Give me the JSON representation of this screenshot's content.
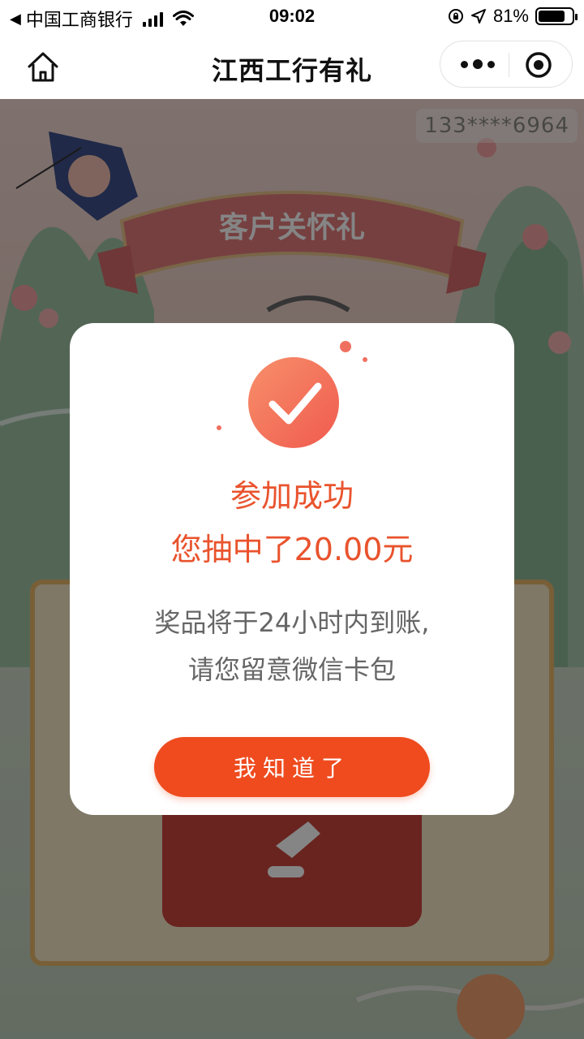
{
  "status_bar": {
    "carrier": "中国工商银行",
    "time": "09:02",
    "battery_percent": "81%",
    "battery_level": 0.81
  },
  "nav": {
    "title": "江西工行有礼"
  },
  "page": {
    "banner_title": "客户关怀礼",
    "phone_masked": "133****6964"
  },
  "modal": {
    "title": "参加成功",
    "prize": "您抽中了20.00元",
    "desc_line1": "奖品将于24小时内到账,",
    "desc_line2": "请您留意微信卡包",
    "confirm_label": "我知道了"
  },
  "colors": {
    "accent": "#ef4b1f",
    "title_text": "#e9532d",
    "body_text": "#666666",
    "overlay": "rgba(0,0,0,0.48)"
  },
  "icons": [
    "back-arrow-icon",
    "cellular-signal-icon",
    "wifi-icon",
    "rotation-lock-icon",
    "location-icon",
    "battery-icon",
    "home-icon",
    "more-icon",
    "close-miniprogram-icon",
    "checkmark-icon"
  ]
}
